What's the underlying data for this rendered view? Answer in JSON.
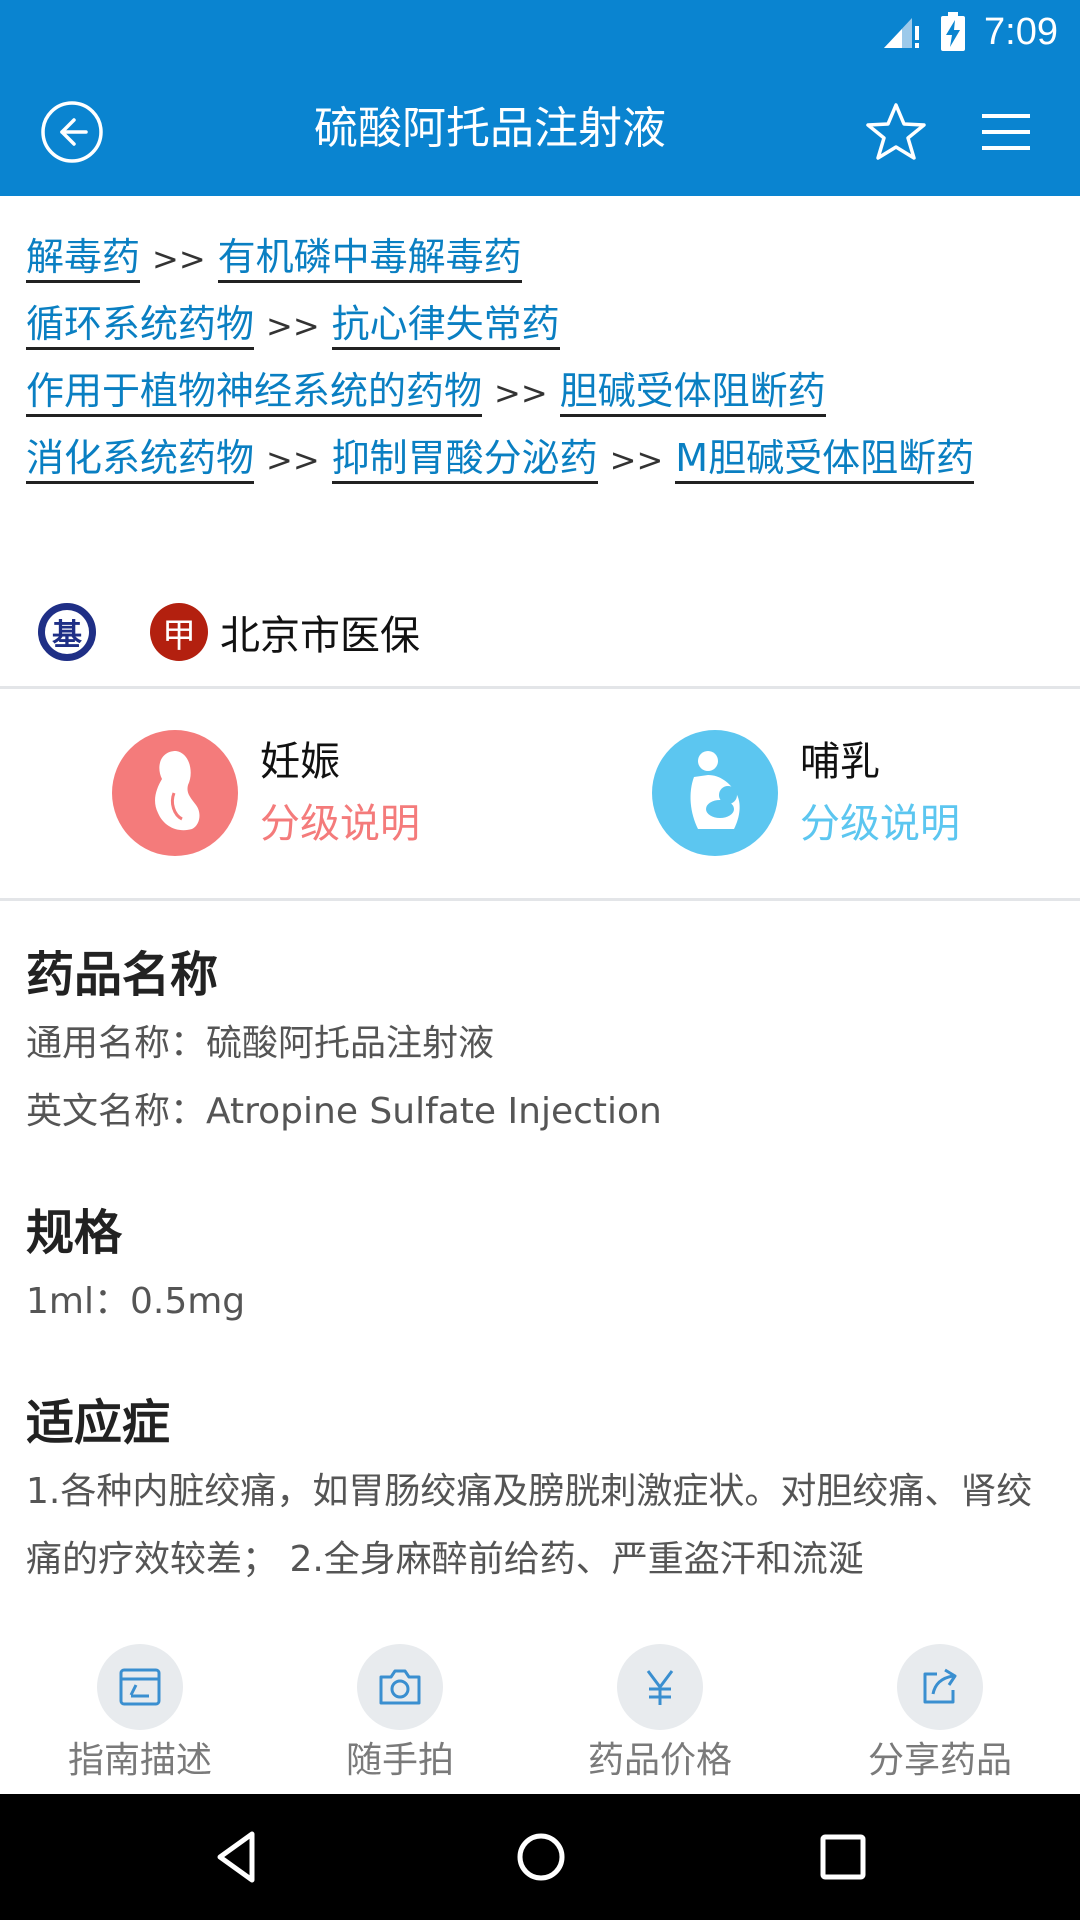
{
  "status_bar": {
    "time": "7:09"
  },
  "app_bar": {
    "title": "硫酸阿托品注射液"
  },
  "categories": [
    {
      "links": [
        "解毒药",
        "有机磷中毒解毒药"
      ]
    },
    {
      "links": [
        "循环系统药物",
        "抗心律失常药"
      ]
    },
    {
      "links": [
        "作用于植物神经系统的药物",
        "胆碱受体阻断药"
      ]
    },
    {
      "links": [
        "消化系统药物",
        "抑制胃酸分泌药",
        "M胆碱受体阻断药"
      ]
    }
  ],
  "separator": ">>",
  "insurance": {
    "badge_ji": "基",
    "badge_jia": "甲",
    "label": "北京市医保"
  },
  "pregnancy": {
    "title": "妊娠",
    "link": "分级说明",
    "color": "#f47b7b"
  },
  "lactation": {
    "title": "哺乳",
    "link": "分级说明",
    "color": "#5cc6f0"
  },
  "drug_name": {
    "title": "药品名称",
    "generic": "通用名称：硫酸阿托品注射液",
    "english": "英文名称：Atropine Sulfate Injection"
  },
  "spec": {
    "title": "规格",
    "value": "1ml：0.5mg"
  },
  "indications": {
    "title": "适应症",
    "text": "1.各种内脏绞痛，如胃肠绞痛及膀胱刺激症状。对胆绞痛、肾绞痛的疗效较差； 2.全身麻醉前给药、严重盗汗和流涎"
  },
  "toolbar": [
    {
      "label": "指南描述",
      "icon": "guide-icon"
    },
    {
      "label": "随手拍",
      "icon": "camera-icon"
    },
    {
      "label": "药品价格",
      "icon": "yuan-icon"
    },
    {
      "label": "分享药品",
      "icon": "share-icon"
    }
  ],
  "colors": {
    "primary": "#0a84d0",
    "link": "#0a7fc2"
  }
}
